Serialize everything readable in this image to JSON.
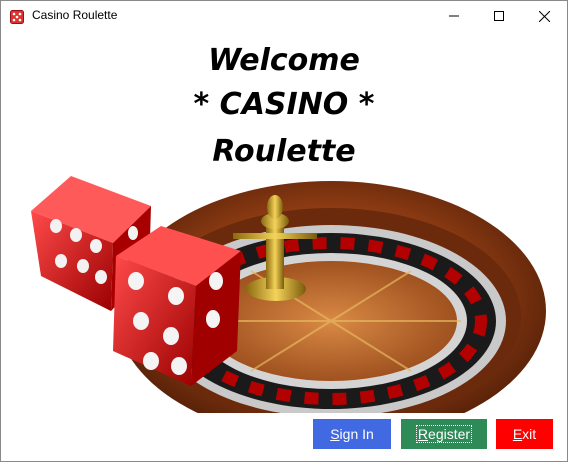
{
  "window": {
    "title": "Casino Roulette",
    "icon": "dice-icon",
    "controls": [
      "minimize-icon",
      "maximize-icon",
      "close-icon"
    ]
  },
  "heading": {
    "line1": "Welcome",
    "line2": "* CASINO *",
    "line3": "Roulette"
  },
  "image": {
    "icon": "roulette-wheel-with-dice-image"
  },
  "buttons": {
    "sign_in": {
      "underline": "S",
      "rest": "ign In",
      "color": "#4169e1"
    },
    "register": {
      "underline": "R",
      "rest": "egister",
      "color": "#2e8b57"
    },
    "exit": {
      "underline": "E",
      "rest": "xit",
      "color": "#ff0000"
    }
  }
}
